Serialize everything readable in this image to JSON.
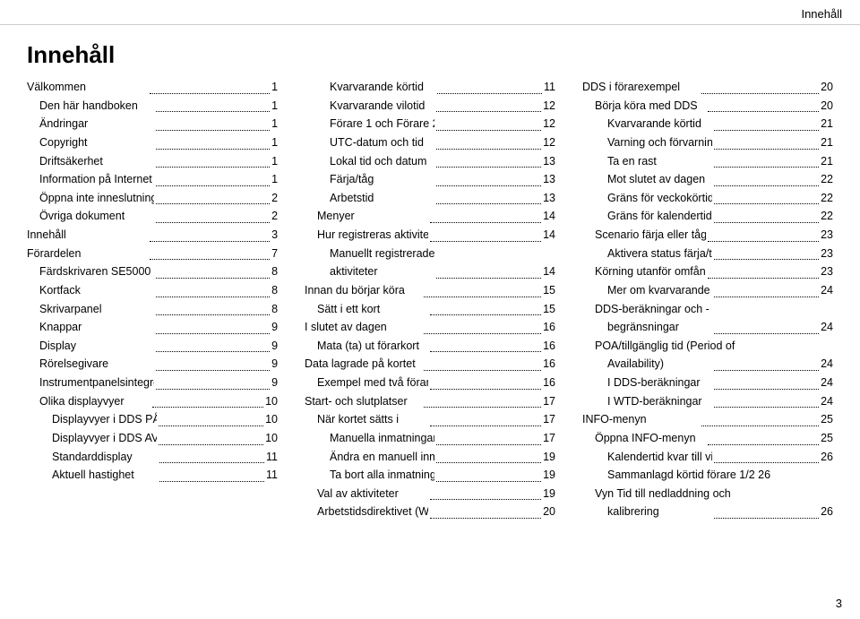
{
  "header": {
    "title": "Innehåll"
  },
  "page_title": "Innehåll",
  "footer_page": "3",
  "columns": {
    "col1": {
      "entries": [
        {
          "label": "Välkommen",
          "dots": true,
          "page": "1",
          "indent": 0,
          "bold": false
        },
        {
          "label": "Den här handboken",
          "dots": true,
          "page": "1",
          "indent": 1,
          "bold": false
        },
        {
          "label": "Ändringar",
          "dots": true,
          "page": "1",
          "indent": 1,
          "bold": false
        },
        {
          "label": "Copyright",
          "dots": true,
          "page": "1",
          "indent": 1,
          "bold": false
        },
        {
          "label": "Driftsäkerhet",
          "dots": true,
          "page": "1",
          "indent": 1,
          "bold": false
        },
        {
          "label": "Information på Internet",
          "dots": true,
          "page": "1",
          "indent": 1,
          "bold": false
        },
        {
          "label": "Öppna inte inneslutningen",
          "dots": true,
          "page": "2",
          "indent": 1,
          "bold": false
        },
        {
          "label": "Övriga dokument",
          "dots": true,
          "page": "2",
          "indent": 1,
          "bold": false
        },
        {
          "label": "Innehåll",
          "dots": true,
          "page": "3",
          "indent": 0,
          "bold": false
        },
        {
          "label": "Förardelen",
          "dots": true,
          "page": "7",
          "indent": 0,
          "bold": false
        },
        {
          "label": "Färdskrivaren SE5000",
          "dots": true,
          "page": "8",
          "indent": 1,
          "bold": false
        },
        {
          "label": "Kortfack",
          "dots": true,
          "page": "8",
          "indent": 1,
          "bold": false
        },
        {
          "label": "Skrivarpanel",
          "dots": true,
          "page": "8",
          "indent": 1,
          "bold": false
        },
        {
          "label": "Knappar",
          "dots": true,
          "page": "9",
          "indent": 1,
          "bold": false
        },
        {
          "label": "Display",
          "dots": true,
          "page": "9",
          "indent": 1,
          "bold": false
        },
        {
          "label": "Rörelsegivare",
          "dots": true,
          "page": "9",
          "indent": 1,
          "bold": false
        },
        {
          "label": "Instrumentpanelsintegrering",
          "dots": true,
          "page": "9",
          "indent": 1,
          "bold": false
        },
        {
          "label": "Olika displayvyer",
          "dots": true,
          "page": "10",
          "indent": 1,
          "bold": false
        },
        {
          "label": "Displayvyer i DDS PÅ",
          "dots": true,
          "page": "10",
          "indent": 2,
          "bold": false
        },
        {
          "label": "Displayvyer i DDS AV",
          "dots": true,
          "page": "10",
          "indent": 2,
          "bold": false
        },
        {
          "label": "Standarddisplay",
          "dots": true,
          "page": "11",
          "indent": 2,
          "bold": false
        },
        {
          "label": "Aktuell hastighet",
          "dots": true,
          "page": "11",
          "indent": 2,
          "bold": false
        }
      ]
    },
    "col2": {
      "entries": [
        {
          "label": "Kvarvarande körtid",
          "dots": true,
          "page": "11",
          "indent": 2,
          "bold": false
        },
        {
          "label": "Kvarvarande vilotid",
          "dots": true,
          "page": "12",
          "indent": 2,
          "bold": false
        },
        {
          "label": "Förare 1 och Förare 2",
          "dots": true,
          "page": "12",
          "indent": 2,
          "bold": false
        },
        {
          "label": "UTC-datum och tid",
          "dots": true,
          "page": "12",
          "indent": 2,
          "bold": false
        },
        {
          "label": "Lokal tid och datum",
          "dots": true,
          "page": "13",
          "indent": 2,
          "bold": false
        },
        {
          "label": "Färja/tåg",
          "dots": true,
          "page": "13",
          "indent": 2,
          "bold": false
        },
        {
          "label": "Arbetstid",
          "dots": true,
          "page": "13",
          "indent": 2,
          "bold": false
        },
        {
          "label": "Menyer",
          "dots": true,
          "page": "14",
          "indent": 1,
          "bold": false
        },
        {
          "label": "Hur registreras aktiviteter?",
          "dots": true,
          "page": "14",
          "indent": 1,
          "bold": false
        },
        {
          "label": "Manuellt registrerade",
          "dots": false,
          "page": "",
          "indent": 2,
          "bold": false
        },
        {
          "label": "aktiviteter",
          "dots": true,
          "page": "14",
          "indent": 2,
          "bold": false
        },
        {
          "label": "Innan du börjar köra",
          "dots": true,
          "page": "15",
          "indent": 0,
          "bold": false
        },
        {
          "label": "Sätt i ett kort",
          "dots": true,
          "page": "15",
          "indent": 1,
          "bold": false
        },
        {
          "label": "I slutet av dagen",
          "dots": true,
          "page": "16",
          "indent": 0,
          "bold": false
        },
        {
          "label": "Mata (ta) ut förarkort",
          "dots": true,
          "page": "16",
          "indent": 1,
          "bold": false
        },
        {
          "label": "Data lagrade på kortet",
          "dots": true,
          "page": "16",
          "indent": 0,
          "bold": false
        },
        {
          "label": "Exempel med två förare",
          "dots": true,
          "page": "16",
          "indent": 1,
          "bold": false
        },
        {
          "label": "Start- och slutplatser",
          "dots": true,
          "page": "17",
          "indent": 0,
          "bold": false
        },
        {
          "label": "När kortet sätts i",
          "dots": true,
          "page": "17",
          "indent": 1,
          "bold": false
        },
        {
          "label": "Manuella inmatningar",
          "dots": true,
          "page": "17",
          "indent": 2,
          "bold": false
        },
        {
          "label": "Ändra en manuell inmatning",
          "dots": true,
          "page": "19",
          "indent": 2,
          "bold": false
        },
        {
          "label": "Ta bort alla inmatningar",
          "dots": true,
          "page": "19",
          "indent": 2,
          "bold": false
        },
        {
          "label": "Val av aktiviteter",
          "dots": true,
          "page": "19",
          "indent": 1,
          "bold": false
        },
        {
          "label": "Arbetstidsdirektivet (WTD)",
          "dots": true,
          "page": "20",
          "indent": 1,
          "bold": false
        }
      ]
    },
    "col3": {
      "entries": [
        {
          "label": "DDS i förarexempel",
          "dots": true,
          "page": "20",
          "indent": 0,
          "bold": false
        },
        {
          "label": "Börja köra med DDS",
          "dots": true,
          "page": "20",
          "indent": 1,
          "bold": false
        },
        {
          "label": "Kvarvarande körtid",
          "dots": true,
          "page": "21",
          "indent": 2,
          "bold": false
        },
        {
          "label": "Varning och förvarning",
          "dots": true,
          "page": "21",
          "indent": 2,
          "bold": false
        },
        {
          "label": "Ta en rast",
          "dots": true,
          "page": "21",
          "indent": 2,
          "bold": false
        },
        {
          "label": "Mot slutet av dagen",
          "dots": true,
          "page": "22",
          "indent": 2,
          "bold": false
        },
        {
          "label": "Gräns för veckokörtid",
          "dots": true,
          "page": "22",
          "indent": 2,
          "bold": false
        },
        {
          "label": "Gräns för kalendertid",
          "dots": true,
          "page": "22",
          "indent": 2,
          "bold": false
        },
        {
          "label": "Scenario färja eller tåg",
          "dots": true,
          "page": "23",
          "indent": 1,
          "bold": false
        },
        {
          "label": "Aktivera status färja/tåg",
          "dots": true,
          "page": "23",
          "indent": 2,
          "bold": false
        },
        {
          "label": "Körning utanför omfång",
          "dots": true,
          "page": "23",
          "indent": 1,
          "bold": false
        },
        {
          "label": "Mer om kvarvarande körtid",
          "dots": true,
          "page": "24",
          "indent": 2,
          "bold": false
        },
        {
          "label": "DDS-beräkningar och -",
          "dots": false,
          "page": "",
          "indent": 1,
          "bold": false
        },
        {
          "label": "begränsningar",
          "dots": true,
          "page": "24",
          "indent": 2,
          "bold": false
        },
        {
          "label": "POA/tillgänglig tid (Period of",
          "dots": false,
          "page": "",
          "indent": 1,
          "bold": false
        },
        {
          "label": "Availability)",
          "dots": true,
          "page": "24",
          "indent": 2,
          "bold": false
        },
        {
          "label": "I DDS-beräkningar",
          "dots": true,
          "page": "24",
          "indent": 2,
          "bold": false
        },
        {
          "label": "I WTD-beräkningar",
          "dots": true,
          "page": "24",
          "indent": 2,
          "bold": false
        },
        {
          "label": "INFO-menyn",
          "dots": true,
          "page": "25",
          "indent": 0,
          "bold": false
        },
        {
          "label": "Öppna INFO-menyn",
          "dots": true,
          "page": "25",
          "indent": 1,
          "bold": false
        },
        {
          "label": "Kalendertid kvar till vila",
          "dots": true,
          "page": "26",
          "indent": 2,
          "bold": false
        },
        {
          "label": "Sammanlagd körtid förare 1/2 26",
          "dots": false,
          "page": "",
          "indent": 2,
          "bold": false
        },
        {
          "label": "Vyn Tid till nedladdning och",
          "dots": false,
          "page": "",
          "indent": 1,
          "bold": false
        },
        {
          "label": "kalibrering",
          "dots": true,
          "page": "26",
          "indent": 2,
          "bold": false
        }
      ]
    }
  }
}
